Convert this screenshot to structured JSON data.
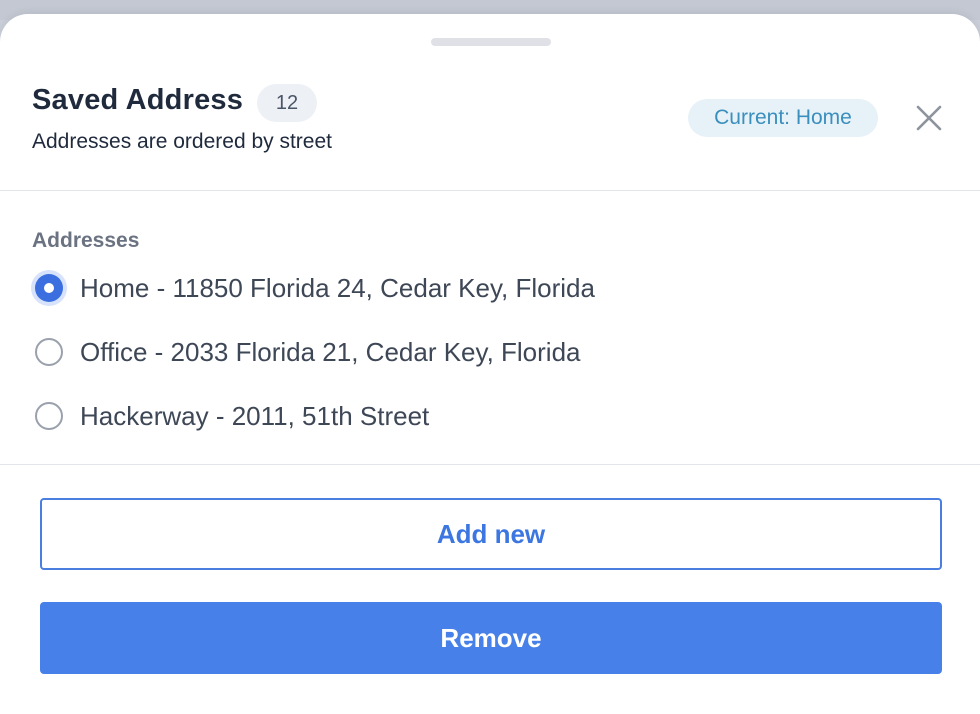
{
  "sheet": {
    "title": "Saved Address",
    "count": "12",
    "subtitle": "Addresses are ordered by street",
    "current_label": "Current: Home",
    "close_icon": "close-icon"
  },
  "addresses": {
    "section_label": "Addresses",
    "selected_index": 0,
    "items": [
      {
        "label": "Home - 11850 Florida 24, Cedar Key, Florida",
        "selected": true
      },
      {
        "label": "Office - 2033 Florida 21, Cedar Key, Florida",
        "selected": false
      },
      {
        "label": "Hackerway - 2011, 51th Street",
        "selected": false
      }
    ]
  },
  "actions": {
    "add_label": "Add new",
    "remove_label": "Remove"
  },
  "colors": {
    "accent": "#4680e8",
    "title": "#1f2a3d",
    "pill_text": "#3a8fbd",
    "pill_bg": "#e7f1f8"
  }
}
